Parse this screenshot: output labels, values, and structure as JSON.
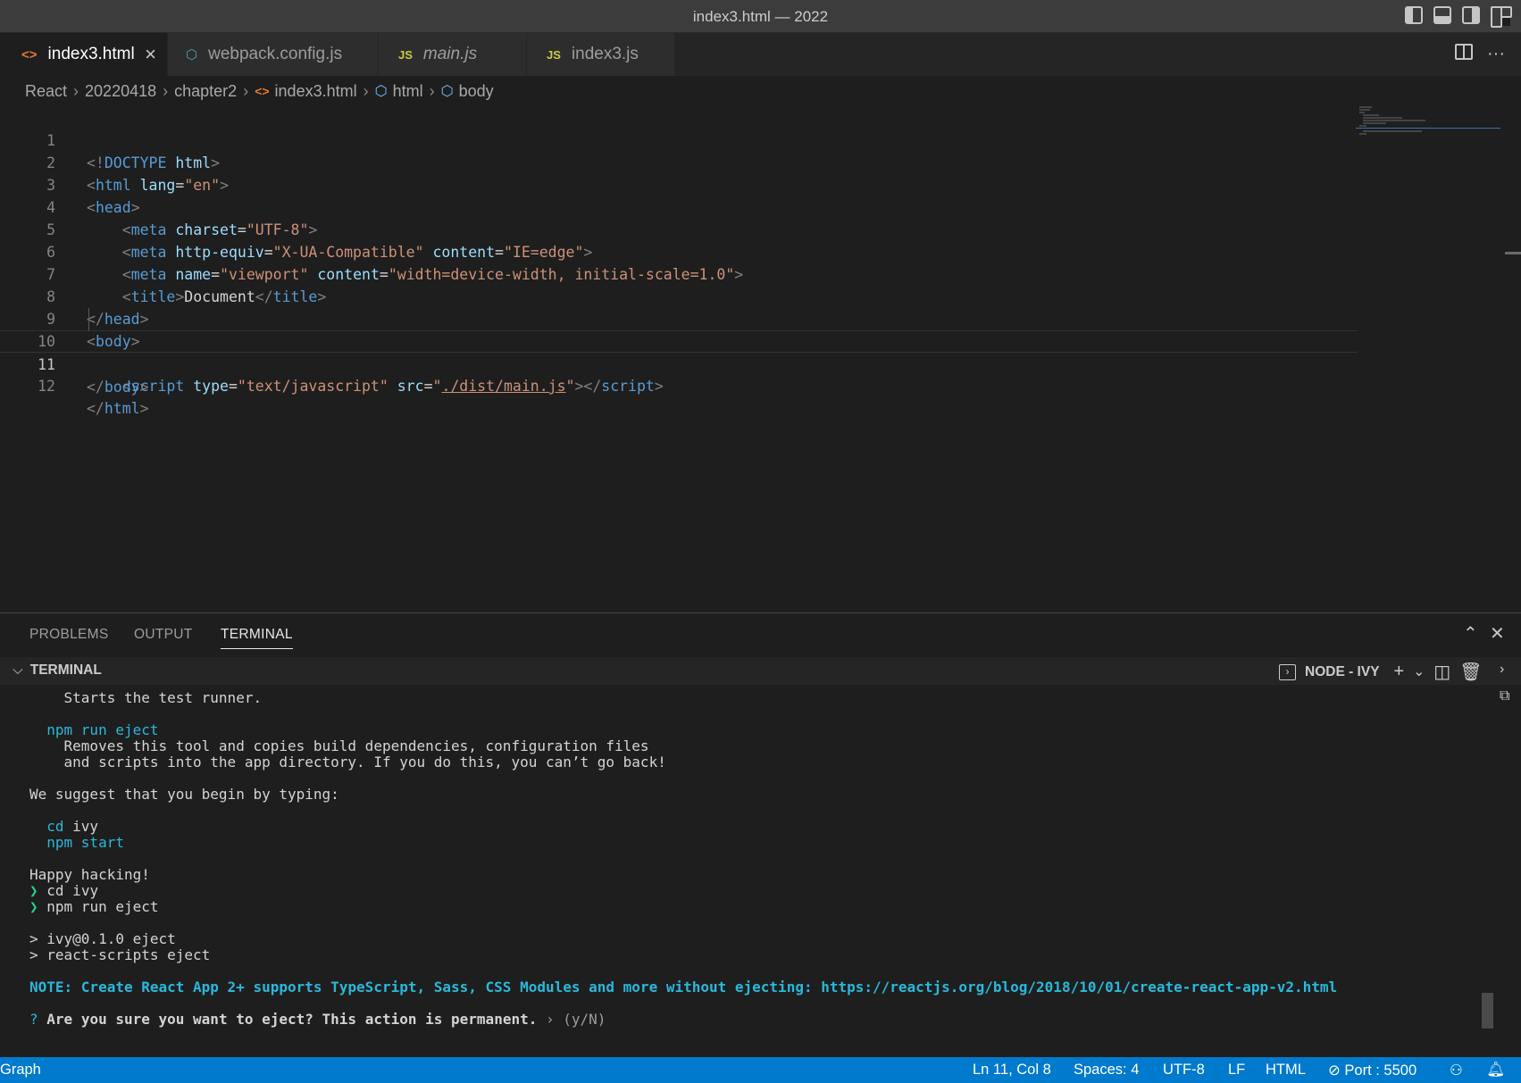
{
  "window": {
    "title": "index3.html — 2022"
  },
  "tabs": [
    {
      "label": "index3.html",
      "icon": "html-icon",
      "active": true
    },
    {
      "label": "webpack.config.js",
      "icon": "webpack-icon"
    },
    {
      "label": "main.js",
      "icon": "js-icon",
      "italic": true
    },
    {
      "label": "index3.js",
      "icon": "js-icon"
    }
  ],
  "tab_icon_js": "JS",
  "tab_icon_html": "<>",
  "breadcrumb": [
    "React",
    "20220418",
    "chapter2",
    "index3.html",
    "html",
    "body"
  ],
  "editor": {
    "current_line": 11,
    "lines": [
      {
        "n": "1"
      },
      {
        "n": "2"
      },
      {
        "n": "3"
      },
      {
        "n": "4"
      },
      {
        "n": "5"
      },
      {
        "n": "6"
      },
      {
        "n": "7"
      },
      {
        "n": "8"
      },
      {
        "n": "9"
      },
      {
        "n": "10"
      },
      {
        "n": "11"
      },
      {
        "n": "12"
      }
    ]
  },
  "panel": {
    "tabs": [
      "PROBLEMS",
      "OUTPUT",
      "TERMINAL"
    ],
    "active_tab": "TERMINAL",
    "terminal_header": "TERMINAL",
    "shell_name": "NODE - IVY"
  },
  "terminal": {
    "lines": [
      "    Starts the test runner.",
      "",
      "  npm run eject",
      "    Removes this tool and copies build dependencies, configuration files",
      "    and scripts into the app directory. If you do this, you can’t go back!",
      "",
      "We suggest that you begin by typing:",
      "",
      "  cd ivy",
      "  npm start",
      "",
      "Happy hacking!",
      "cd ivy",
      "npm run eject",
      "",
      "> ivy@0.1.0 eject",
      "> react-scripts eject",
      "",
      "NOTE: Create React App 2+ supports TypeScript, Sass, CSS Modules and more without ejecting: https://reactjs.org/blog/2018/10/01/create-react-app-v2.html",
      "",
      "Are you sure you want to eject? This action is permanent.",
      "› (y/N)"
    ],
    "prompt_char": "❯",
    "question_char": "?"
  },
  "statusbar": {
    "left": "Graph",
    "position": "Ln 11, Col 8",
    "spaces": "Spaces: 4",
    "encoding": "UTF-8",
    "eol": "LF",
    "language": "HTML",
    "port": "Port : 5500"
  },
  "colors": {
    "statusbar": "#007acc",
    "tag": "#569cd6",
    "attr": "#9cdcfe",
    "string": "#ce9178",
    "terminal_cyan": "#29b8db",
    "prompt_green": "#23d18b"
  }
}
